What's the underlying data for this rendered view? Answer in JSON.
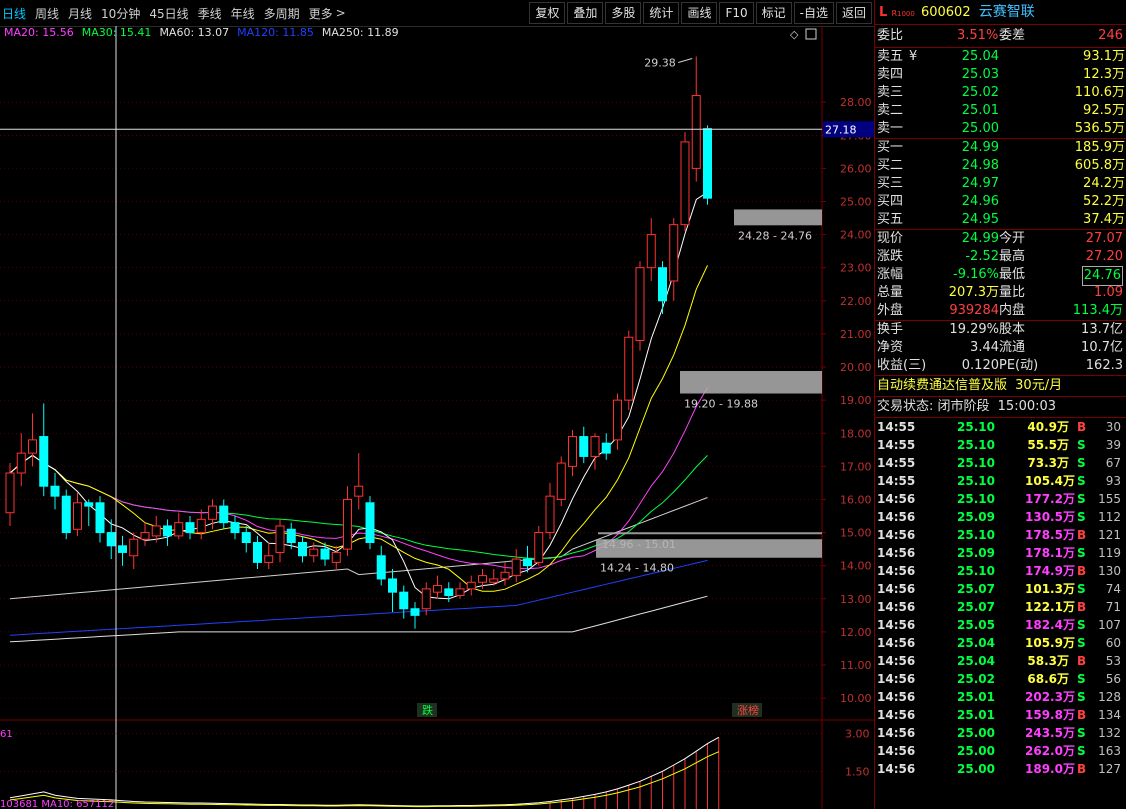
{
  "toolbar": {
    "periods": [
      "日线",
      "周线",
      "月线",
      "10分钟",
      "45日线",
      "季线",
      "年线",
      "多周期",
      "更多"
    ],
    "more_arrow": ">",
    "buttons": [
      "复权",
      "叠加",
      "多股",
      "统计",
      "画线",
      "F10",
      "标记",
      "-自选",
      "返回"
    ]
  },
  "ma_legend": [
    {
      "label": "MA20: 15.56",
      "color": "#ff40ff"
    },
    {
      "label": "MA30: 15.41",
      "color": "#00ff40"
    },
    {
      "label": "MA60: 13.07",
      "color": "#e0e0e0"
    },
    {
      "label": "MA120: 11.85",
      "color": "#2040ff"
    },
    {
      "label": "MA250: 11.89",
      "color": "#e0e0e0"
    }
  ],
  "chart_data": {
    "type": "candlestick",
    "price_axis": [
      "28.00",
      "27.00",
      "26.00",
      "25.00",
      "24.00",
      "23.00",
      "22.00",
      "21.00",
      "20.00",
      "19.00",
      "18.00",
      "17.00",
      "16.00",
      "15.00",
      "14.00",
      "13.00",
      "12.00",
      "11.00",
      "10.00"
    ],
    "crosshair_price": "27.18",
    "high_label": "29.38",
    "gap_labels": [
      "24.28 - 24.76",
      "19.20 - 19.88",
      "14.96 - 15.01",
      "14.24 - 14.80"
    ],
    "markers": [
      "跌",
      "涨榜"
    ],
    "volume_axis": [
      "3.00",
      "1.50"
    ],
    "volume_indicator_label": "61",
    "bottom_label": "103681  MA10: 657112",
    "candles": [
      {
        "o": 15.6,
        "c": 16.8,
        "h": 17.1,
        "l": 15.2
      },
      {
        "o": 16.8,
        "c": 17.4,
        "h": 18.0,
        "l": 16.4
      },
      {
        "o": 17.4,
        "c": 17.8,
        "h": 18.6,
        "l": 17.0
      },
      {
        "o": 17.9,
        "c": 16.4,
        "h": 18.9,
        "l": 16.1
      },
      {
        "o": 16.4,
        "c": 16.1,
        "h": 16.8,
        "l": 15.7
      },
      {
        "o": 16.1,
        "c": 15.0,
        "h": 16.3,
        "l": 14.8
      },
      {
        "o": 15.1,
        "c": 15.9,
        "h": 16.2,
        "l": 14.9
      },
      {
        "o": 15.9,
        "c": 15.8,
        "h": 16.0,
        "l": 15.2
      },
      {
        "o": 15.9,
        "c": 15.0,
        "h": 16.1,
        "l": 14.7
      },
      {
        "o": 15.0,
        "c": 14.6,
        "h": 15.4,
        "l": 14.2
      },
      {
        "o": 14.6,
        "c": 14.4,
        "h": 14.9,
        "l": 14.0
      },
      {
        "o": 14.3,
        "c": 14.8,
        "h": 15.0,
        "l": 13.9
      },
      {
        "o": 14.8,
        "c": 15.0,
        "h": 15.3,
        "l": 14.6
      },
      {
        "o": 14.9,
        "c": 15.2,
        "h": 15.5,
        "l": 14.7
      },
      {
        "o": 15.2,
        "c": 14.9,
        "h": 15.4,
        "l": 14.6
      },
      {
        "o": 14.9,
        "c": 15.3,
        "h": 15.6,
        "l": 14.8
      },
      {
        "o": 15.3,
        "c": 15.0,
        "h": 15.5,
        "l": 14.8
      },
      {
        "o": 15.0,
        "c": 15.4,
        "h": 15.7,
        "l": 14.8
      },
      {
        "o": 15.4,
        "c": 15.8,
        "h": 16.0,
        "l": 15.1
      },
      {
        "o": 15.8,
        "c": 15.3,
        "h": 16.0,
        "l": 15.1
      },
      {
        "o": 15.3,
        "c": 15.0,
        "h": 15.5,
        "l": 14.8
      },
      {
        "o": 15.0,
        "c": 14.7,
        "h": 15.2,
        "l": 14.4
      },
      {
        "o": 14.7,
        "c": 14.1,
        "h": 14.9,
        "l": 13.9
      },
      {
        "o": 14.1,
        "c": 14.3,
        "h": 14.7,
        "l": 13.9
      },
      {
        "o": 14.4,
        "c": 15.2,
        "h": 15.4,
        "l": 14.1
      },
      {
        "o": 15.1,
        "c": 14.7,
        "h": 15.3,
        "l": 14.5
      },
      {
        "o": 14.7,
        "c": 14.3,
        "h": 14.9,
        "l": 14.1
      },
      {
        "o": 14.3,
        "c": 14.5,
        "h": 14.7,
        "l": 14.1
      },
      {
        "o": 14.5,
        "c": 14.2,
        "h": 14.7,
        "l": 14.0
      },
      {
        "o": 14.1,
        "c": 14.4,
        "h": 14.6,
        "l": 13.9
      },
      {
        "o": 14.5,
        "c": 16.0,
        "h": 16.4,
        "l": 14.3
      },
      {
        "o": 16.1,
        "c": 16.4,
        "h": 17.4,
        "l": 15.7
      },
      {
        "o": 15.9,
        "c": 14.7,
        "h": 16.1,
        "l": 14.5
      },
      {
        "o": 14.3,
        "c": 13.6,
        "h": 14.6,
        "l": 13.4
      },
      {
        "o": 13.6,
        "c": 13.2,
        "h": 13.9,
        "l": 12.6
      },
      {
        "o": 13.2,
        "c": 12.7,
        "h": 13.4,
        "l": 12.4
      },
      {
        "o": 12.7,
        "c": 12.5,
        "h": 12.9,
        "l": 12.1
      },
      {
        "o": 12.7,
        "c": 13.3,
        "h": 13.5,
        "l": 12.5
      },
      {
        "o": 13.2,
        "c": 13.4,
        "h": 13.7,
        "l": 13.0
      },
      {
        "o": 13.3,
        "c": 13.1,
        "h": 13.5,
        "l": 12.9
      },
      {
        "o": 13.1,
        "c": 13.3,
        "h": 13.5,
        "l": 13.0
      },
      {
        "o": 13.3,
        "c": 13.5,
        "h": 13.7,
        "l": 13.1
      },
      {
        "o": 13.5,
        "c": 13.7,
        "h": 13.9,
        "l": 13.3
      },
      {
        "o": 13.5,
        "c": 13.6,
        "h": 13.9,
        "l": 13.4
      },
      {
        "o": 13.6,
        "c": 13.8,
        "h": 14.1,
        "l": 13.4
      },
      {
        "o": 13.7,
        "c": 14.2,
        "h": 14.5,
        "l": 13.5
      },
      {
        "o": 14.2,
        "c": 14.0,
        "h": 14.6,
        "l": 13.8
      },
      {
        "o": 14.1,
        "c": 15.0,
        "h": 15.2,
        "l": 14.0
      },
      {
        "o": 15.0,
        "c": 16.1,
        "h": 16.5,
        "l": 14.8
      },
      {
        "o": 16.0,
        "c": 17.1,
        "h": 17.3,
        "l": 15.8
      },
      {
        "o": 17.0,
        "c": 17.9,
        "h": 18.1,
        "l": 16.7
      },
      {
        "o": 17.9,
        "c": 17.3,
        "h": 18.2,
        "l": 17.1
      },
      {
        "o": 17.3,
        "c": 17.9,
        "h": 18.0,
        "l": 16.9
      },
      {
        "o": 17.7,
        "c": 17.4,
        "h": 18.0,
        "l": 17.2
      },
      {
        "o": 17.8,
        "c": 19.0,
        "h": 19.2,
        "l": 17.5
      },
      {
        "o": 19.0,
        "c": 20.9,
        "h": 21.1,
        "l": 18.7
      },
      {
        "o": 20.8,
        "c": 23.0,
        "h": 23.2,
        "l": 20.5
      },
      {
        "o": 23.0,
        "c": 24.0,
        "h": 24.5,
        "l": 22.6
      },
      {
        "o": 23.0,
        "c": 22.0,
        "h": 23.2,
        "l": 21.6
      },
      {
        "o": 22.6,
        "c": 24.3,
        "h": 24.5,
        "l": 22.0
      },
      {
        "o": 24.3,
        "c": 26.8,
        "h": 27.1,
        "l": 24.1
      },
      {
        "o": 26.0,
        "c": 28.2,
        "h": 29.38,
        "l": 25.6
      },
      {
        "o": 27.2,
        "c": 25.1,
        "h": 27.3,
        "l": 24.9
      }
    ],
    "volume": [
      0.45,
      0.52,
      0.6,
      0.68,
      0.55,
      0.48,
      0.42,
      0.4,
      0.38,
      0.36,
      0.33,
      0.3,
      0.28,
      0.27,
      0.26,
      0.25,
      0.24,
      0.24,
      0.23,
      0.22,
      0.21,
      0.2,
      0.19,
      0.18,
      0.18,
      0.17,
      0.16,
      0.16,
      0.15,
      0.15,
      0.16,
      0.17,
      0.16,
      0.15,
      0.14,
      0.13,
      0.12,
      0.12,
      0.13,
      0.13,
      0.14,
      0.14,
      0.15,
      0.16,
      0.17,
      0.19,
      0.22,
      0.25,
      0.3,
      0.36,
      0.42,
      0.5,
      0.58,
      0.68,
      0.8,
      0.95,
      1.1,
      1.3,
      1.5,
      1.75,
      2.0,
      2.3,
      2.6,
      2.85
    ]
  },
  "right": {
    "market_mark": "L",
    "market_sub": "R",
    "market_num": "1000",
    "code": "600602",
    "name": "云赛智联",
    "weibi_label": "委比",
    "weibi_value": "3.51%",
    "weicha_label": "委差",
    "weicha_value": "246",
    "asks": [
      {
        "label": "卖五",
        "flag": "¥",
        "price": "25.04",
        "vol": "93.1万"
      },
      {
        "label": "卖四",
        "flag": "",
        "price": "25.03",
        "vol": "12.3万"
      },
      {
        "label": "卖三",
        "flag": "",
        "price": "25.02",
        "vol": "110.6万"
      },
      {
        "label": "卖二",
        "flag": "",
        "price": "25.01",
        "vol": "92.5万"
      },
      {
        "label": "卖一",
        "flag": "",
        "price": "25.00",
        "vol": "536.5万"
      }
    ],
    "bids": [
      {
        "label": "买一",
        "price": "24.99",
        "vol": "185.9万"
      },
      {
        "label": "买二",
        "price": "24.98",
        "vol": "605.8万"
      },
      {
        "label": "买三",
        "price": "24.97",
        "vol": "24.2万"
      },
      {
        "label": "买四",
        "price": "24.96",
        "vol": "52.2万"
      },
      {
        "label": "买五",
        "price": "24.95",
        "vol": "37.4万"
      }
    ],
    "quote": [
      {
        "l1": "现价",
        "v1": "24.99",
        "c1": "green",
        "l2": "今开",
        "v2": "27.07",
        "c2": "red"
      },
      {
        "l1": "涨跌",
        "v1": "-2.52",
        "c1": "green",
        "l2": "最高",
        "v2": "27.20",
        "c2": "red"
      },
      {
        "l1": "涨幅",
        "v1": "-9.16%",
        "c1": "green",
        "l2": "最低",
        "v2": "24.76",
        "c2": "green",
        "box": true
      },
      {
        "l1": "总量",
        "v1": "207.3万",
        "c1": "yellow",
        "l2": "量比",
        "v2": "1.09",
        "c2": "red"
      },
      {
        "l1": "外盘",
        "v1": "939284",
        "c1": "red",
        "l2": "内盘",
        "v2": "113.4万",
        "c2": "green"
      }
    ],
    "quote2": [
      {
        "l1": "换手",
        "v1": "19.29%",
        "l2": "股本",
        "v2": "13.7亿"
      },
      {
        "l1": "净资",
        "v1": "3.44",
        "l2": "流通",
        "v2": "10.7亿"
      },
      {
        "l1": "收益(三)",
        "v1": "0.120",
        "l2": "PE(动)",
        "v2": "162.3"
      }
    ],
    "promo": "自动续费通达信普及版",
    "promo_price": "30元/月",
    "trade_state": "交易状态: 闭市阶段",
    "trade_time": "15:00:03",
    "ticks": [
      {
        "t": "14:55",
        "p": "25.10",
        "pc": "green",
        "v": "40.9万",
        "bs": "B",
        "n": "30"
      },
      {
        "t": "14:55",
        "p": "25.10",
        "pc": "green",
        "v": "55.5万",
        "bs": "S",
        "n": "39"
      },
      {
        "t": "14:55",
        "p": "25.10",
        "pc": "green",
        "v": "73.3万",
        "bs": "S",
        "n": "67"
      },
      {
        "t": "14:55",
        "p": "25.10",
        "pc": "green",
        "v": "105.4万",
        "bs": "S",
        "n": "93"
      },
      {
        "t": "14:56",
        "p": "25.10",
        "pc": "green",
        "v": "177.2万",
        "bs": "S",
        "n": "155",
        "vc": "magenta"
      },
      {
        "t": "14:56",
        "p": "25.09",
        "pc": "green",
        "v": "130.5万",
        "bs": "S",
        "n": "112",
        "vc": "magenta"
      },
      {
        "t": "14:56",
        "p": "25.10",
        "pc": "green",
        "v": "178.5万",
        "bs": "B",
        "n": "121",
        "vc": "magenta"
      },
      {
        "t": "14:56",
        "p": "25.09",
        "pc": "green",
        "v": "178.1万",
        "bs": "S",
        "n": "119",
        "vc": "magenta"
      },
      {
        "t": "14:56",
        "p": "25.10",
        "pc": "green",
        "v": "174.9万",
        "bs": "B",
        "n": "130",
        "vc": "magenta"
      },
      {
        "t": "14:56",
        "p": "25.07",
        "pc": "green",
        "v": "101.3万",
        "bs": "S",
        "n": "74"
      },
      {
        "t": "14:56",
        "p": "25.07",
        "pc": "green",
        "v": "122.1万",
        "bs": "B",
        "n": "71"
      },
      {
        "t": "14:56",
        "p": "25.05",
        "pc": "green",
        "v": "182.4万",
        "bs": "S",
        "n": "107",
        "vc": "magenta"
      },
      {
        "t": "14:56",
        "p": "25.04",
        "pc": "green",
        "v": "105.9万",
        "bs": "S",
        "n": "60"
      },
      {
        "t": "14:56",
        "p": "25.04",
        "pc": "green",
        "v": "58.3万",
        "bs": "B",
        "n": "53"
      },
      {
        "t": "14:56",
        "p": "25.02",
        "pc": "green",
        "v": "68.6万",
        "bs": "S",
        "n": "56"
      },
      {
        "t": "14:56",
        "p": "25.01",
        "pc": "green",
        "v": "202.3万",
        "bs": "S",
        "n": "128",
        "vc": "magenta"
      },
      {
        "t": "14:56",
        "p": "25.01",
        "pc": "green",
        "v": "159.8万",
        "bs": "B",
        "n": "134",
        "vc": "magenta"
      },
      {
        "t": "14:56",
        "p": "25.00",
        "pc": "green",
        "v": "243.5万",
        "bs": "S",
        "n": "132",
        "vc": "magenta"
      },
      {
        "t": "14:56",
        "p": "25.00",
        "pc": "green",
        "v": "262.0万",
        "bs": "S",
        "n": "163",
        "vc": "magenta"
      },
      {
        "t": "14:56",
        "p": "25.00",
        "pc": "green",
        "v": "189.0万",
        "bs": "B",
        "n": "127",
        "vc": "magenta"
      }
    ]
  },
  "colors": {
    "up": "#ff3232",
    "down": "#00ffff",
    "grid": "#7a0000",
    "ma5": "#ffffff",
    "ma10": "#ffff00",
    "ma20": "#ff40ff",
    "ma30": "#00ff40",
    "ma120": "#2040ff",
    "ma250": "#e0e0e0"
  }
}
